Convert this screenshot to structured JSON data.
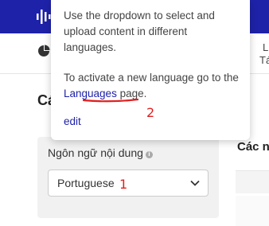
{
  "topbar": {
    "logo_icon": "sound-wave-icon",
    "background": "#1e22a8"
  },
  "subbar": {
    "pie_icon": "pie-chart-icon",
    "right_top_text": "L",
    "right_bottom_text": "Tá"
  },
  "main": {
    "section_heading_left": "Cá",
    "section_heading_right": "Các n",
    "content_language": {
      "label": "Ngôn ngữ nội dung",
      "info_icon": "info-icon",
      "selected_value": "Portuguese",
      "dropdown_icon": "chevron-down-icon"
    }
  },
  "tooltip": {
    "line1": "Use the dropdown to select and upload content in different languages.",
    "line2_prefix": "To activate a new language go to the ",
    "line2_link": "Languages",
    "line2_suffix": " page.",
    "edit_label": "edit",
    "link_color": "#1e22a8"
  },
  "annotations": {
    "marker_1": "1",
    "marker_2": "2",
    "color": "#e02020"
  }
}
